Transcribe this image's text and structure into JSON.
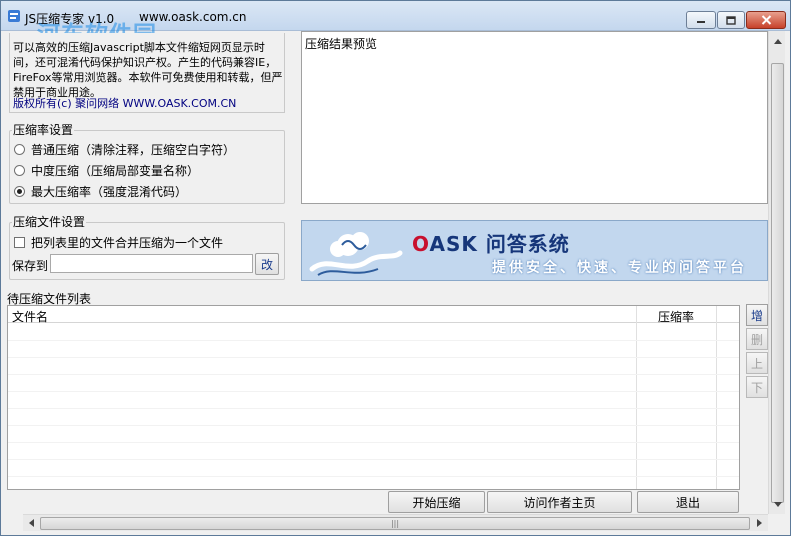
{
  "window": {
    "title": "JS压缩专家 v1.0",
    "url": "www.oask.com.cn",
    "watermark": "河东软件园"
  },
  "about": {
    "text": "可以高效的压缩Javascript脚本文件缩短网页显示时间，还可混淆代码保护知识产权。产生的代码兼容IE，FireFox等常用浏览器。本软件可免费使用和转载，但严禁用于商业用途。",
    "copyright": "版权所有(c) 聚问网络 WWW.OASK.COM.CN"
  },
  "compression": {
    "label": "压缩率设置",
    "options": [
      {
        "label": "普通压缩（清除注释，压缩空白字符）",
        "selected": false
      },
      {
        "label": "中度压缩（压缩局部变量名称）",
        "selected": false
      },
      {
        "label": "最大压缩率（强度混淆代码）",
        "selected": true
      }
    ]
  },
  "file_settings": {
    "label": "压缩文件设置",
    "merge_label": "把列表里的文件合并压缩为一个文件",
    "merge_checked": false,
    "save_label": "保存到",
    "save_value": "",
    "change_button": "改"
  },
  "preview": {
    "label": "压缩结果预览"
  },
  "banner": {
    "title_first": "O",
    "title_rest": "ASK 问答系统",
    "slogan": "提供安全、快速、专业的问答平台"
  },
  "file_list": {
    "title": "待压缩文件列表",
    "columns": [
      "文件名",
      "压缩率"
    ],
    "rows": []
  },
  "side_buttons": [
    {
      "label": "增",
      "enabled": true
    },
    {
      "label": "删",
      "enabled": false
    },
    {
      "label": "上",
      "enabled": false
    },
    {
      "label": "下",
      "enabled": false
    }
  ],
  "actions": {
    "start": "开始压缩",
    "visit": "访问作者主页",
    "exit": "退出"
  },
  "icons": {
    "app": "js-app-icon",
    "minimize": "minimize-icon",
    "maximize": "maximize-icon",
    "close": "close-icon"
  }
}
